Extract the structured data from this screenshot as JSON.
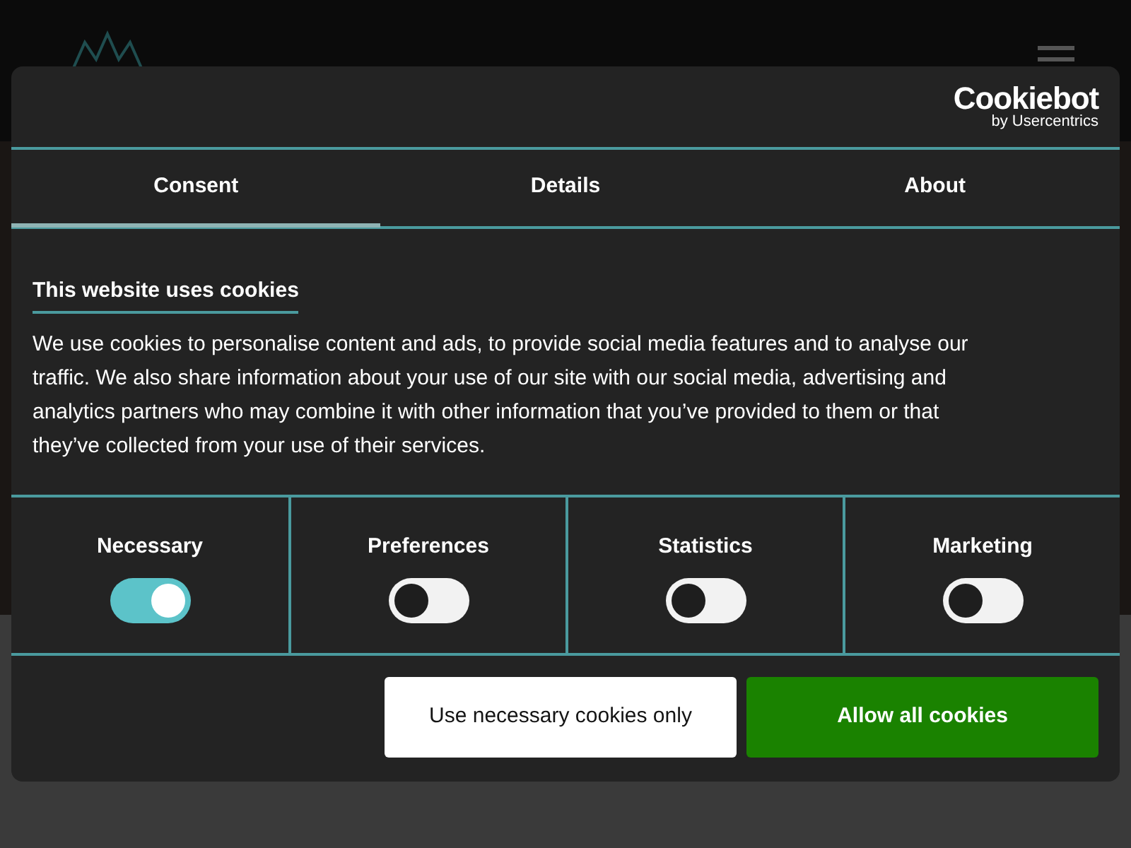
{
  "dialog": {
    "brand": {
      "name": "Cookiebot",
      "byline": "by Usercentrics"
    },
    "tabs": [
      {
        "label": "Consent",
        "selected": true
      },
      {
        "label": "Details",
        "selected": false
      },
      {
        "label": "About",
        "selected": false
      }
    ],
    "heading": "This website uses cookies",
    "body": "We use cookies to personalise content and ads, to provide social media features and to analyse our traffic. We also share information about your use of our site with our social media, advertising and analytics partners who may combine it with other information that you’ve provided to them or that they’ve collected from your use of their services.",
    "categories": [
      {
        "label": "Necessary",
        "on": true
      },
      {
        "label": "Preferences",
        "on": false
      },
      {
        "label": "Statistics",
        "on": false
      },
      {
        "label": "Marketing",
        "on": false
      }
    ],
    "buttons": [
      {
        "label": "Use necessary cookies only",
        "kind": "secondary"
      },
      {
        "label": "Allow all cookies",
        "kind": "primary"
      }
    ]
  }
}
